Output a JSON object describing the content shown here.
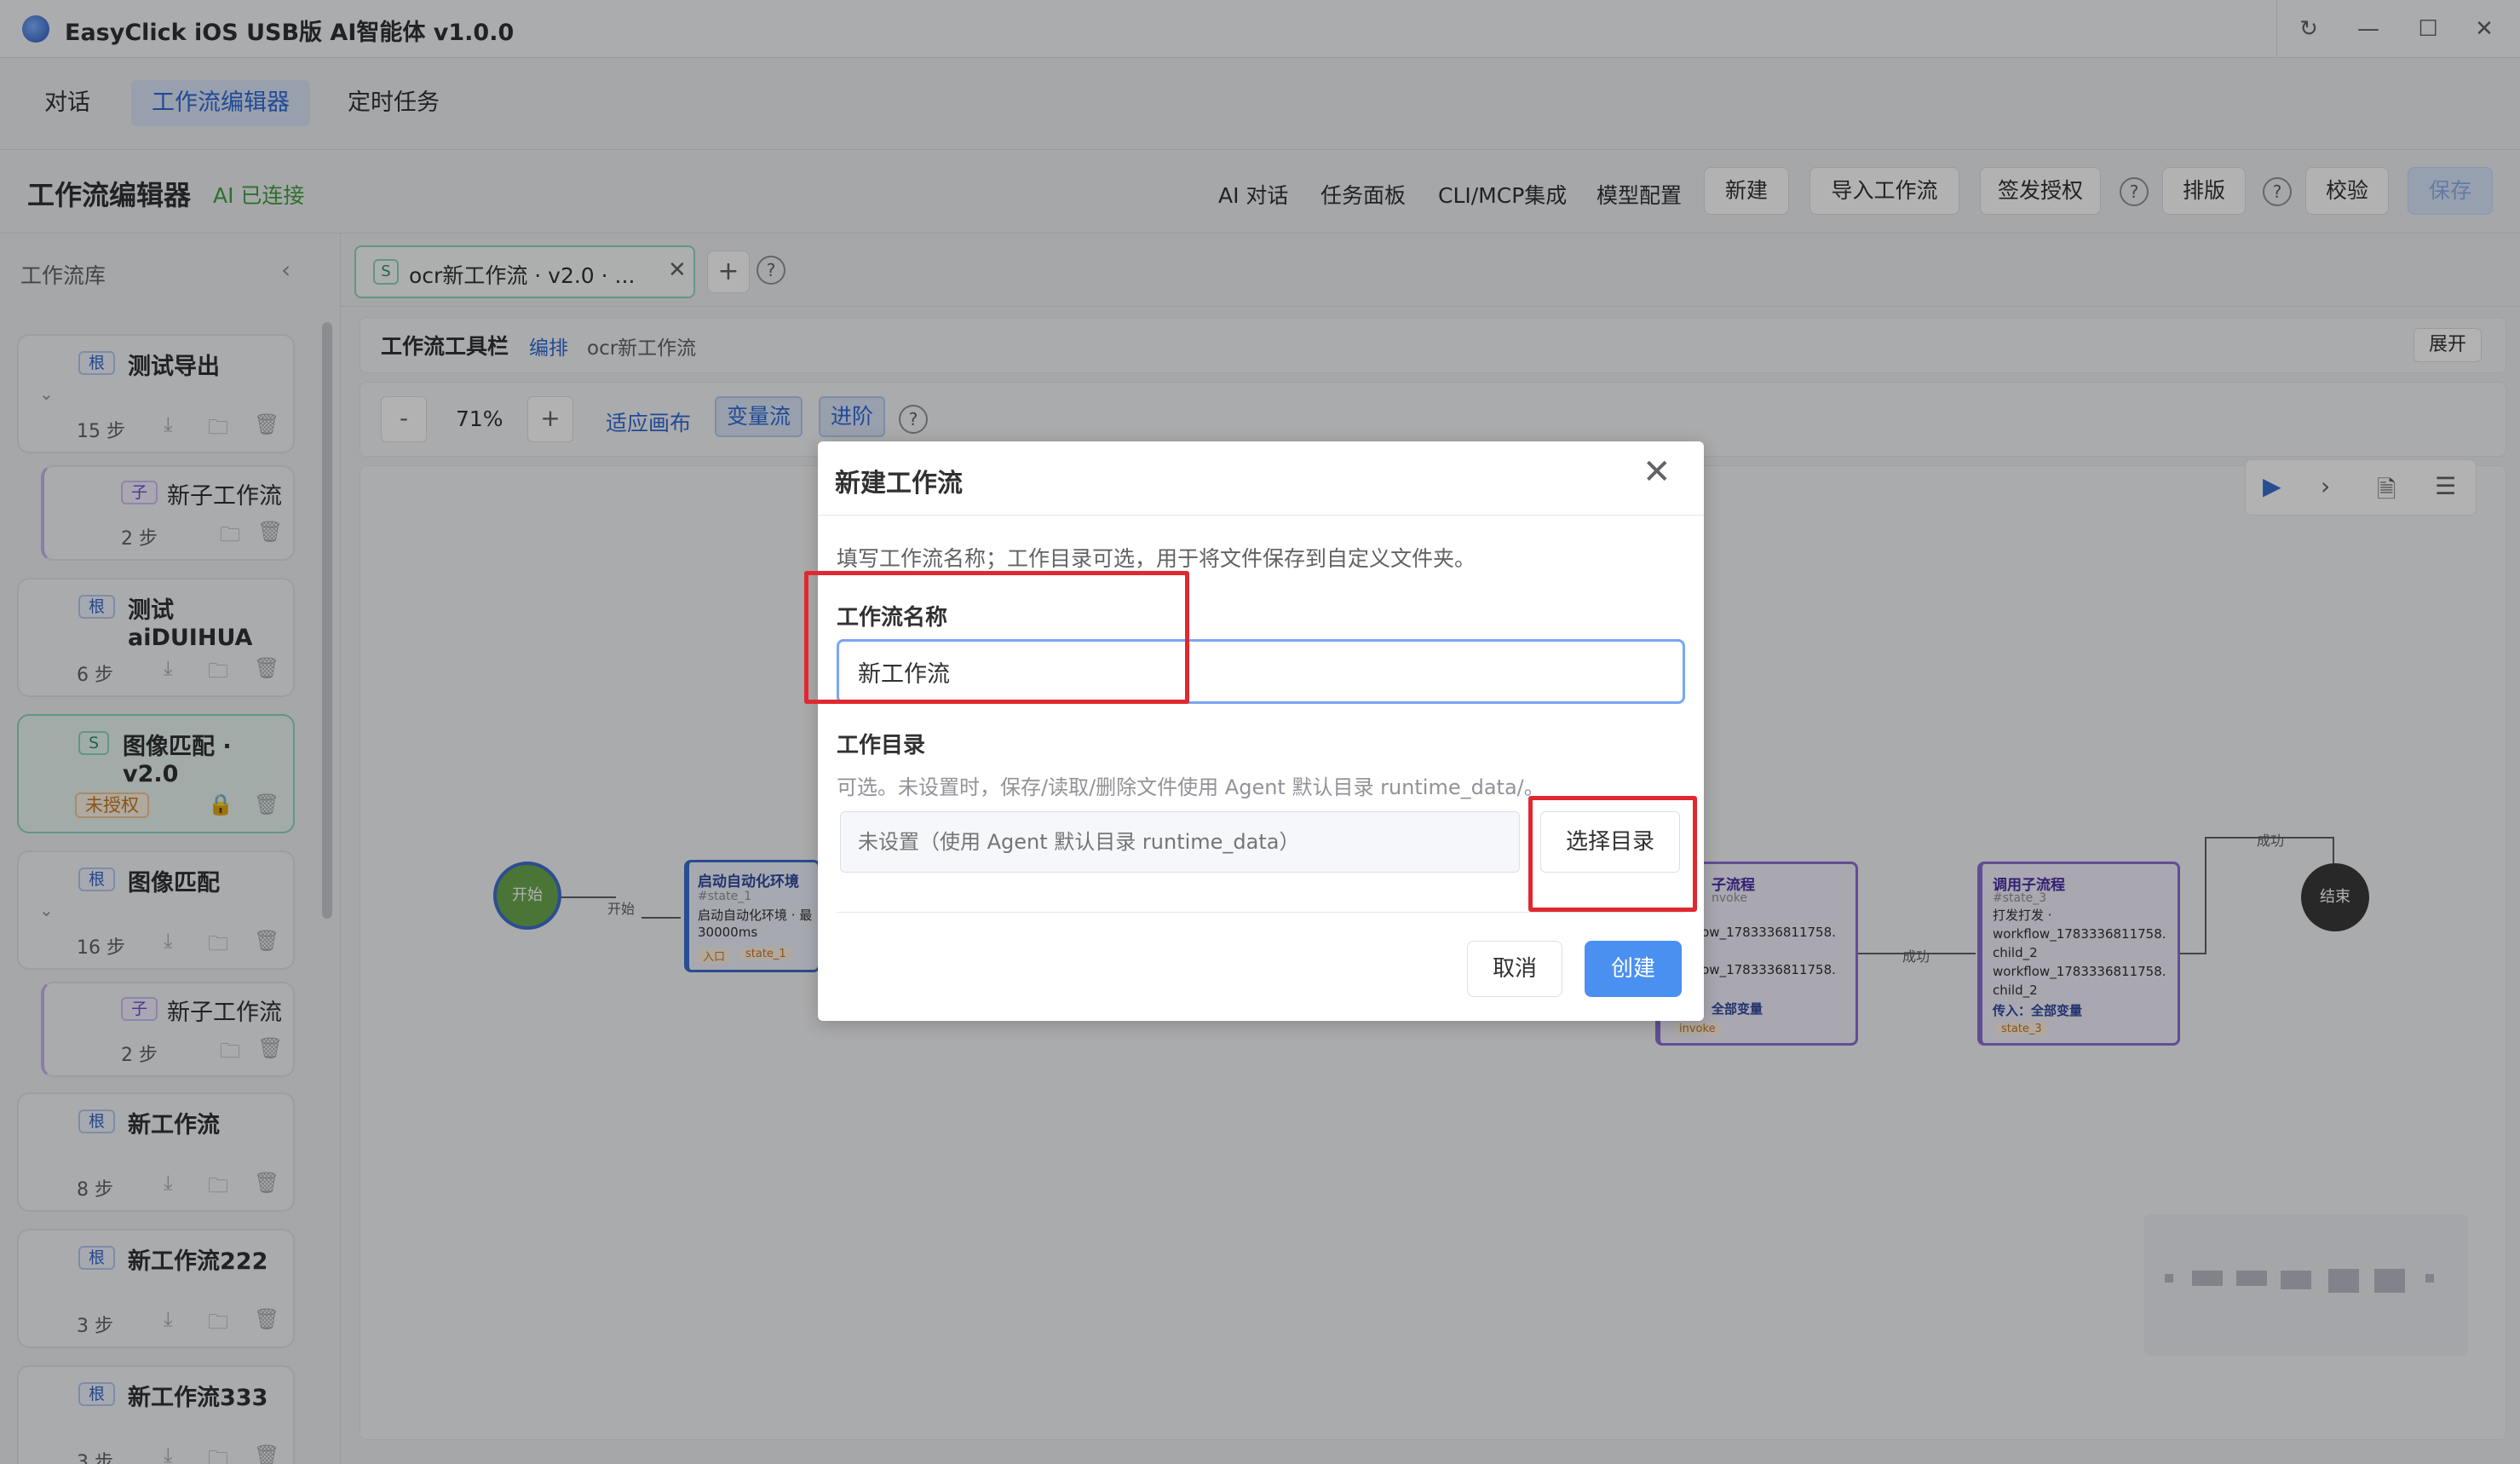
{
  "window": {
    "title": "EasyClick iOS USB版 AI智能体 v1.0.0",
    "controls": {
      "refresh": "↻",
      "minimize": "—",
      "maximize": "☐",
      "close": "✕"
    }
  },
  "main_tabs": [
    {
      "label": "对话"
    },
    {
      "label": "工作流编辑器",
      "active": true
    },
    {
      "label": "定时任务"
    }
  ],
  "header": {
    "title": "工作流编辑器",
    "ai_status": "AI 已连接",
    "links": [
      "AI 对话",
      "任务面板",
      "CLI/MCP集成",
      "模型配置"
    ],
    "buttons": {
      "new": "新建",
      "import": "导入工作流",
      "license": "签发授权",
      "layout": "排版",
      "validate": "校验",
      "save": "保存"
    },
    "help": "?"
  },
  "sidebar": {
    "title": "工作流库",
    "collapse": "‹",
    "cards": [
      {
        "badge": "根",
        "name": "测试导出",
        "steps": "15 步"
      },
      {
        "badge": "子",
        "name": "新子工作流",
        "steps": "2 步"
      },
      {
        "badge": "根",
        "name": "测试aiDUIHUA",
        "steps": "6 步"
      },
      {
        "badge": "S",
        "name": "图像匹配 · v2.0",
        "status": "未授权"
      },
      {
        "badge": "根",
        "name": "图像匹配",
        "steps": "16 步"
      },
      {
        "badge": "子",
        "name": "新子工作流",
        "steps": "2 步"
      },
      {
        "badge": "根",
        "name": "新工作流",
        "steps": "8 步"
      },
      {
        "badge": "根",
        "name": "新工作流222",
        "steps": "3 步"
      },
      {
        "badge": "根",
        "name": "新工作流333",
        "steps": "3 步"
      }
    ]
  },
  "editor_tabs": {
    "active": {
      "badge": "S",
      "label": "ocr新工作流 · v2.0 · ...",
      "close": "✕"
    },
    "add": "+",
    "help": "?"
  },
  "toolbar": {
    "title": "工作流工具栏",
    "edit": "编排",
    "workflow_name": "ocr新工作流",
    "expand": "展开"
  },
  "zoom": {
    "minus": "-",
    "value": "71%",
    "plus": "+",
    "fit": "适应画布",
    "var_flow": "变量流",
    "advanced": "进阶",
    "help": "?"
  },
  "canvas": {
    "start_node": "开始",
    "start_edge": "开始",
    "end_node": "结束",
    "success": "成功",
    "node1": {
      "title": "启动自动化环境",
      "id": "#state_1",
      "text1": "启动自动化环境 · 最",
      "text2": "30000ms",
      "tag1": "入口",
      "tag2": "state_1"
    },
    "node2": {
      "title": "子流程",
      "id": "nvoke",
      "lines": [
        "kflow_1783336811758.",
        "l_1",
        "kflow_1783336811758.",
        "l_1"
      ],
      "vars": "全部变量",
      "tag": "invoke"
    },
    "node3": {
      "title": "调用子流程",
      "id": "#state_3",
      "lines": [
        "打发打发 ·",
        "workflow_1783336811758.",
        "child_2",
        "workflow_1783336811758.",
        "child_2"
      ],
      "vars": "传入：全部变量",
      "tag": "state_3"
    }
  },
  "dialog": {
    "title": "新建工作流",
    "close": "✕",
    "description": "填写工作流名称；工作目录可选，用于将文件保存到自定义文件夹。",
    "name_label": "工作流名称",
    "name_value": "新工作流",
    "dir_label": "工作目录",
    "dir_hint": "可选。未设置时，保存/读取/删除文件使用 Agent 默认目录 runtime_data/。",
    "dir_placeholder": "未设置（使用 Agent 默认目录 runtime_data）",
    "choose_dir": "选择目录",
    "cancel": "取消",
    "create": "创建"
  },
  "colors": {
    "accent": "#4a90f0",
    "highlight": "#e0282e",
    "ok": "#3fa33f"
  }
}
